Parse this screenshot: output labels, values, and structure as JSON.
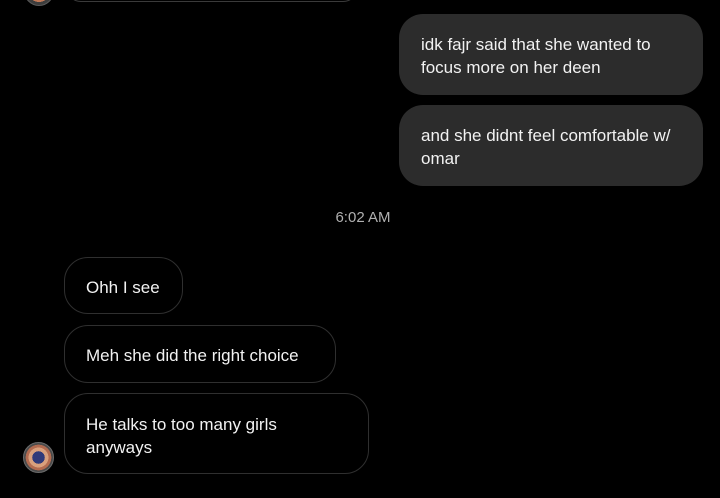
{
  "conversation": {
    "sent_messages": [
      {
        "text": "idk fajr said that she wanted to focus more on her deen"
      },
      {
        "text": "and she didnt feel comfortable w/ omar"
      }
    ],
    "timestamp": "6:02 AM",
    "received_messages": [
      {
        "text": "Ohh I see"
      },
      {
        "text": "Meh she did the right choice"
      },
      {
        "text": "He talks to too many girls anyways"
      }
    ]
  },
  "avatar": {
    "icon": "profile-avatar",
    "colors": {
      "inner": "#303a7a",
      "ring": "#d9a07d",
      "outer": "#4a4a4a"
    }
  },
  "colors": {
    "background": "#000000",
    "sent_bubble": "#2c2c2c",
    "received_border": "#2f2f2f",
    "timestamp_text": "#b0b0b0"
  }
}
